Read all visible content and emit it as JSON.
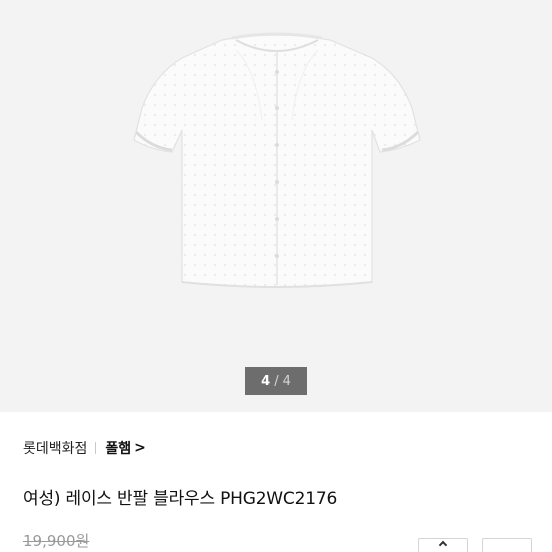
{
  "gallery": {
    "image_alt": "white short-sleeve lace blouse",
    "current_page": "4",
    "separator": "/",
    "total_pages": "4"
  },
  "breadcrumb": {
    "store": "롯데백화점",
    "brand": "폴햄",
    "chevron": ">"
  },
  "product": {
    "title": "여성) 레이스 반팔 블라우스 PHG2WC2176",
    "original_price": "19,900원"
  },
  "colors": {
    "gallery_bg": "#f3f3f3",
    "indicator_bg": "#6d6d6d",
    "strike_price": "#9a9a9a"
  }
}
